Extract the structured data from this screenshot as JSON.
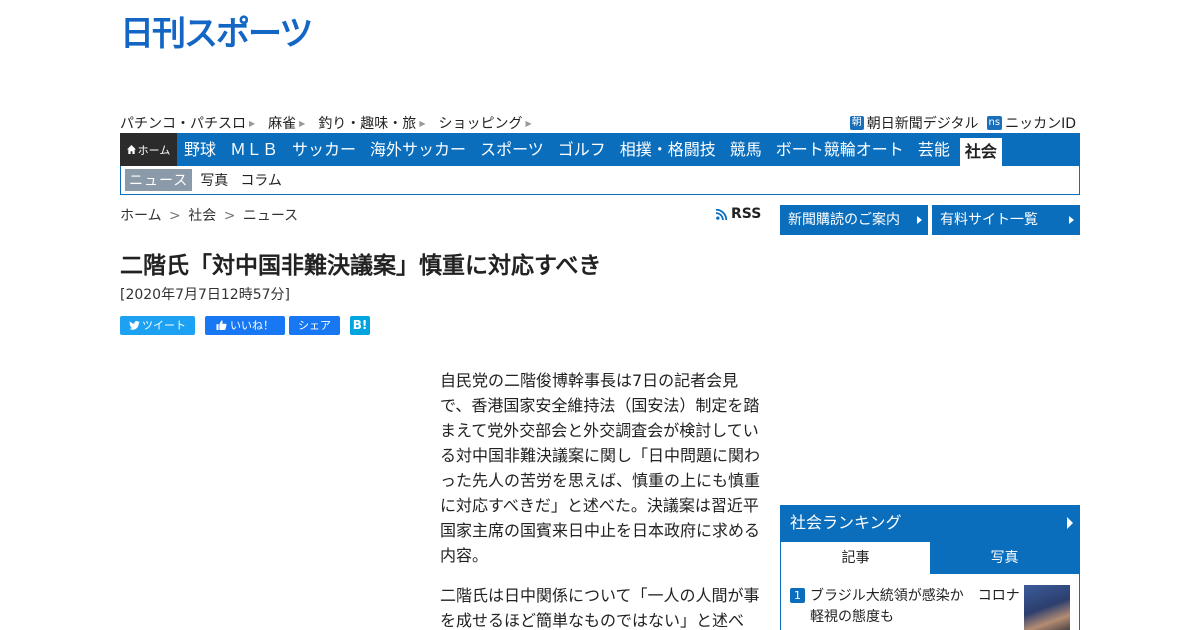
{
  "logo": {
    "text": "日刊スポーツ"
  },
  "subnav": {
    "links": [
      "パチンコ・パチスロ",
      "麻雀",
      "釣り・趣味・旅",
      "ショッピング"
    ],
    "right": [
      {
        "badge": "朝",
        "label": "朝日新聞デジタル"
      },
      {
        "badge": "ns",
        "label": "ニッカンID"
      }
    ]
  },
  "mainnav": {
    "home": "ホーム",
    "items": [
      "野球",
      "ＭＬＢ",
      "サッカー",
      "海外サッカー",
      "スポーツ",
      "ゴルフ",
      "相撲・格闘技",
      "競馬",
      "ボート競輪オート",
      "芸能"
    ],
    "active": "社会"
  },
  "catbar": {
    "current": "ニュース",
    "links": [
      "写真",
      "コラム"
    ]
  },
  "breadcrumb": {
    "items": [
      "ホーム",
      "社会",
      "ニュース"
    ],
    "sep": ">"
  },
  "rss": "RSS",
  "article": {
    "title": "二階氏「対中国非難決議案」慎重に対応すべき",
    "date": "[2020年7月7日12時57分]",
    "paragraphs": [
      "自民党の二階俊博幹事長は7日の記者会見で、香港国家安全維持法（国安法）制定を踏まえて党外交部会と外交調査会が検討している対中国非難決議案に関し「日中問題に関わった先人の苦労を思えば、慎重の上にも慎重に対応すべきだ」と述べた。決議案は習近平国家主席の国賓来日中止を日本政府に求める内容。",
      "二階氏は日中関係について「一人の人間が事を成せるほど簡単なものではない」と述べ"
    ]
  },
  "social": {
    "tweet": "ツイート",
    "like": "いいね！",
    "share": "シェア",
    "hatena": "B!"
  },
  "sidebar": {
    "buttons": [
      "新聞購読のご案内",
      "有料サイト一覧"
    ],
    "ranking": {
      "title": "社会ランキング",
      "tabs": [
        "記事",
        "写真"
      ],
      "items": [
        {
          "rank": "1",
          "text": "ブラジル大統領が感染か　コロナ軽視の態度も"
        }
      ]
    }
  },
  "colors": {
    "brand": "#0a6ebd",
    "logo": "#1466c4",
    "twitter": "#1da1f2",
    "facebook": "#1877f2",
    "hatena": "#00a4de"
  }
}
